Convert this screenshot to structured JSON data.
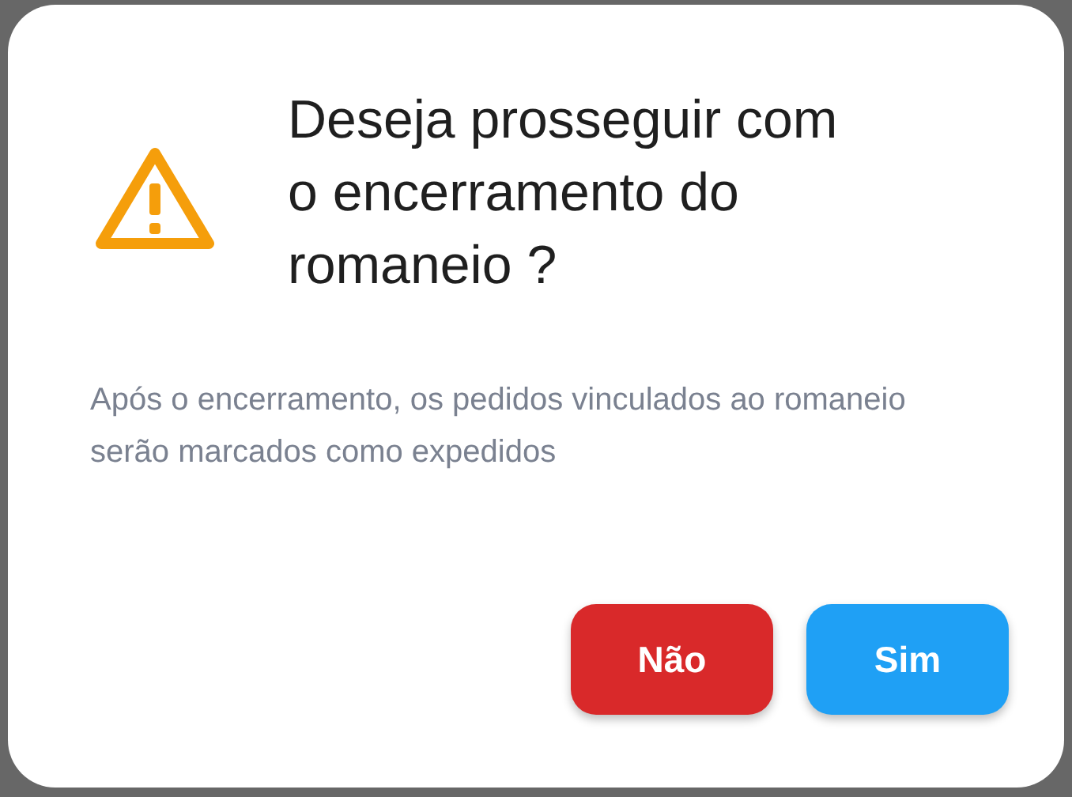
{
  "dialog": {
    "title": "Deseja prosseguir com o encerramento do romaneio ?",
    "message": "Após o encerramento, os pedidos vinculados ao romaneio serão marcados como expedidos",
    "buttons": [
      {
        "label": "Não",
        "kind": "cancel"
      },
      {
        "label": "Sim",
        "kind": "confirm"
      }
    ]
  }
}
